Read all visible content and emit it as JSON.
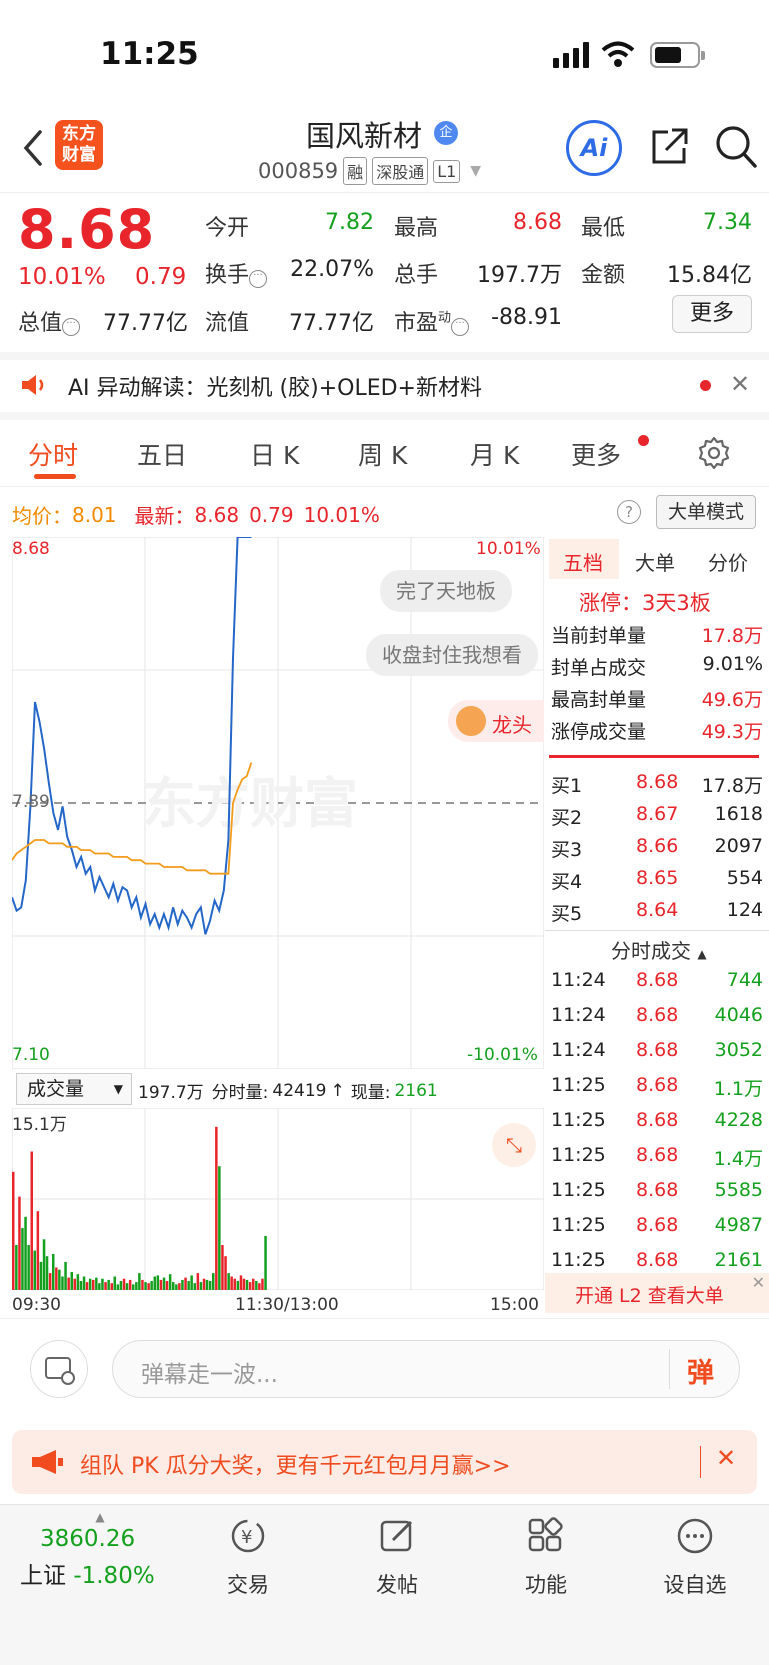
{
  "status_bar": {
    "time": "11:25"
  },
  "header": {
    "logo_line1": "东方",
    "logo_line2": "财富",
    "stock_name": "国风新材",
    "qi_badge": "企",
    "stock_code": "000859",
    "tags": [
      "融",
      "深股通",
      "L1"
    ],
    "ai_label": "Ai"
  },
  "quote": {
    "price": "8.68",
    "change_pct": "10.01%",
    "change": "0.79",
    "fields": [
      {
        "label": "今开",
        "value": "7.82",
        "color": "#14a01e"
      },
      {
        "label": "最高",
        "value": "8.68",
        "color": "#e8252b"
      },
      {
        "label": "最低",
        "value": "7.34",
        "color": "#14a01e"
      },
      {
        "label": "换手",
        "value": "22.07%",
        "color": "#222222"
      },
      {
        "label": "总手",
        "value": "197.7万",
        "color": "#222222"
      },
      {
        "label": "金额",
        "value": "15.84亿",
        "color": "#222222"
      },
      {
        "label": "总值",
        "value": "77.77亿",
        "color": "#222222"
      },
      {
        "label": "流值",
        "value": "77.77亿",
        "color": "#222222"
      },
      {
        "label": "市盈",
        "value": "-88.91",
        "color": "#222222"
      }
    ],
    "pe_superscript": "动",
    "more_label": "更多"
  },
  "ai_banner": {
    "text": "AI 异动解读：光刻机 (胶)+OLED+新材料"
  },
  "tabs": [
    "分时",
    "五日",
    "日 K",
    "周 K",
    "月 K",
    "更多"
  ],
  "avg_row": {
    "avg_label": "均价：",
    "avg_value": "8.01",
    "latest_label": "最新：",
    "latest_value": "8.68",
    "change": "0.79",
    "pct": "10.01%",
    "big_order_btn": "大单模式"
  },
  "chart_data": {
    "type": "line",
    "title": "",
    "y_top_label": "8.68",
    "y_bottom_label": "7.10",
    "y_mid_label": "7.89",
    "pct_top_label": "10.01%",
    "pct_bottom_label": "-10.01%",
    "ylim": [
      7.1,
      8.68
    ],
    "watermark": "东方财富",
    "x_labels": [
      "09:30",
      "11:30/13:00",
      "15:00"
    ],
    "series": [
      {
        "values": [
          7.61,
          7.57,
          7.58,
          7.66,
          7.88,
          8.19,
          8.13,
          8.05,
          7.95,
          7.86,
          7.81,
          7.88,
          7.79,
          7.75,
          7.7,
          7.73,
          7.68,
          7.7,
          7.63,
          7.67,
          7.64,
          7.61,
          7.65,
          7.6,
          7.64,
          7.63,
          7.58,
          7.61,
          7.55,
          7.59,
          7.53,
          7.56,
          7.52,
          7.56,
          7.52,
          7.58,
          7.53,
          7.57,
          7.55,
          7.52,
          7.56,
          7.58,
          7.5,
          7.54,
          7.6,
          7.57,
          7.63,
          7.78,
          8.32,
          8.68,
          8.68,
          8.68,
          8.68
        ]
      },
      {
        "values": [
          7.72,
          7.74,
          7.75,
          7.76,
          7.77,
          7.78,
          7.78,
          7.78,
          7.77,
          7.77,
          7.77,
          7.77,
          7.76,
          7.76,
          7.76,
          7.75,
          7.75,
          7.75,
          7.74,
          7.74,
          7.74,
          7.74,
          7.73,
          7.73,
          7.73,
          7.73,
          7.72,
          7.72,
          7.72,
          7.71,
          7.71,
          7.71,
          7.71,
          7.7,
          7.7,
          7.7,
          7.7,
          7.7,
          7.69,
          7.69,
          7.69,
          7.69,
          7.69,
          7.68,
          7.68,
          7.68,
          7.68,
          7.68,
          7.89,
          7.93,
          7.96,
          7.97,
          8.01
        ]
      }
    ],
    "volume": {
      "label": "成交量",
      "max_label": "15.1万",
      "ymax": 15.1,
      "values": [
        10.5,
        4,
        8.3,
        5.5,
        6.5,
        4,
        12.3,
        3.5,
        7,
        2.5,
        4.5,
        3,
        1.5,
        3.2,
        2,
        1.8,
        1.2,
        2.5,
        1.1,
        1.6,
        1,
        1.4,
        0.8,
        1.2,
        0.7,
        1,
        0.9,
        1.1,
        0.6,
        1,
        0.7,
        0.9,
        0.6,
        1.2,
        0.5,
        0.8,
        1,
        0.6,
        0.9,
        0.5,
        0.7,
        1.5,
        0.9,
        0.7,
        0.6,
        0.8,
        1.2,
        1.3,
        0.9,
        1.1,
        0.8,
        1.4,
        0.7,
        0.5,
        0.6,
        0.9,
        1.1,
        0.8,
        1.3,
        0.6,
        1.5,
        0.7,
        1,
        0.9,
        0.8,
        1.5,
        14.5,
        11,
        4,
        3,
        1.5,
        1.2,
        1,
        0.8,
        1.3,
        1,
        0.9,
        0.7,
        1,
        0.8,
        0.6,
        1,
        4.8
      ],
      "colors": "rg"
    }
  },
  "danmaku": [
    "完了天地板",
    "收盘封住我想看",
    "龙头"
  ],
  "volume_info": {
    "total": "197.7万",
    "minute_label": "分时量:",
    "minute_value": "42419",
    "now_label": "现量:",
    "now_value": "2161"
  },
  "right_panel": {
    "tabs": [
      "五档",
      "大单",
      "分价"
    ],
    "limit_up": "涨停：3天3板",
    "stats": [
      {
        "label": "当前封单量",
        "value": "17.8万",
        "color": "#e8252b"
      },
      {
        "label": "封单占成交",
        "value": "9.01%",
        "color": "#222222"
      },
      {
        "label": "最高封单量",
        "value": "49.6万",
        "color": "#e8252b"
      },
      {
        "label": "涨停成交量",
        "value": "49.3万",
        "color": "#e8252b"
      }
    ],
    "bids": [
      {
        "label": "买1",
        "price": "8.68",
        "vol": "17.8万"
      },
      {
        "label": "买2",
        "price": "8.67",
        "vol": "1618"
      },
      {
        "label": "买3",
        "price": "8.66",
        "vol": "2097"
      },
      {
        "label": "买4",
        "price": "8.65",
        "vol": "554"
      },
      {
        "label": "买5",
        "price": "8.64",
        "vol": "124"
      }
    ],
    "trades_title": "分时成交",
    "trades": [
      {
        "time": "11:24",
        "price": "8.68",
        "vol": "744"
      },
      {
        "time": "11:24",
        "price": "8.68",
        "vol": "4046"
      },
      {
        "time": "11:24",
        "price": "8.68",
        "vol": "3052"
      },
      {
        "time": "11:25",
        "price": "8.68",
        "vol": "1.1万"
      },
      {
        "time": "11:25",
        "price": "8.68",
        "vol": "4228"
      },
      {
        "time": "11:25",
        "price": "8.68",
        "vol": "1.4万"
      },
      {
        "time": "11:25",
        "price": "8.68",
        "vol": "5585"
      },
      {
        "time": "11:25",
        "price": "8.68",
        "vol": "4987"
      },
      {
        "time": "11:25",
        "price": "8.68",
        "vol": "2161"
      }
    ],
    "l2_banner": "开通 L2 查看大单"
  },
  "comment": {
    "placeholder": "弹幕走一波...",
    "send_label": "弹"
  },
  "promo": {
    "text": "组队 PK 瓜分大奖，更有千元红包月月赢>>"
  },
  "bottom_nav": {
    "index_value": "3860.26",
    "index_name": "上证",
    "index_change": "-1.80%",
    "items": [
      "交易",
      "发帖",
      "功能",
      "设自选"
    ]
  }
}
